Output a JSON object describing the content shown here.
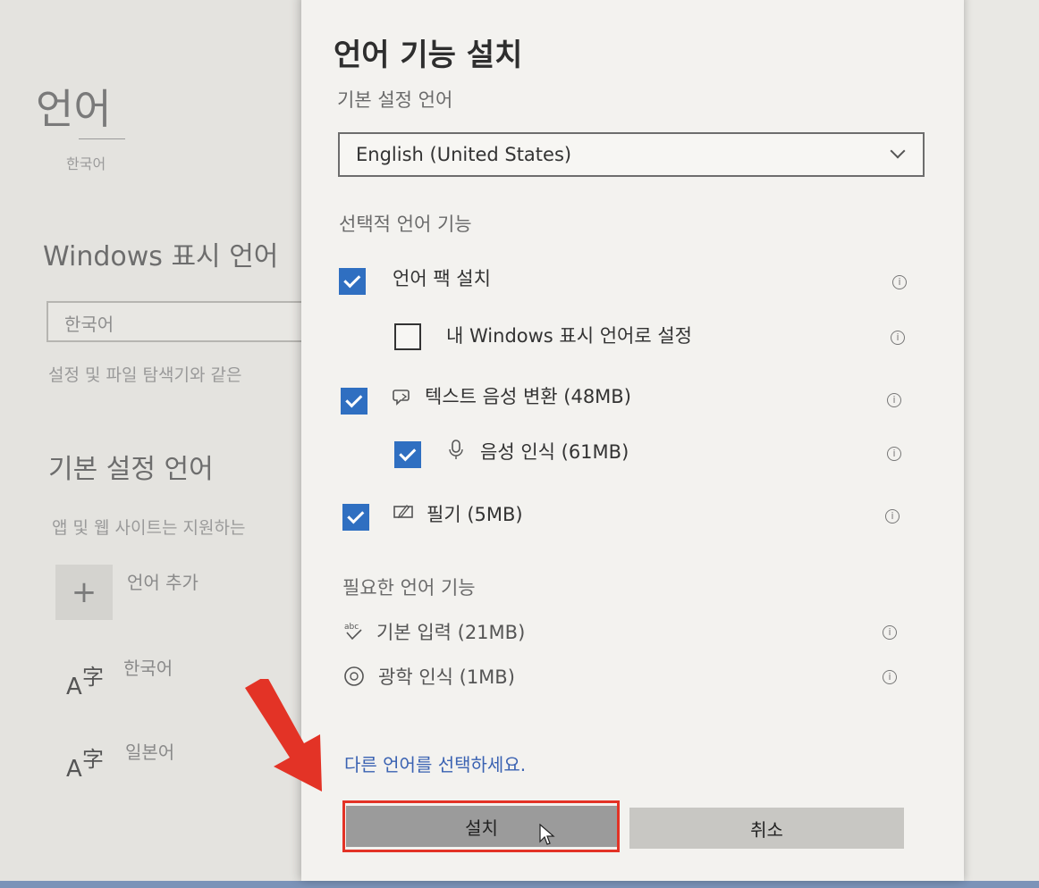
{
  "background": {
    "page_title": "언어",
    "breadcrumb": "한국어",
    "display_language_heading": "Windows 표시 언어",
    "display_language_value": "한국어",
    "display_language_desc": "설정 및 파일 탐색기와 같은",
    "preferred_heading": "기본 설정 언어",
    "preferred_desc": "앱 및 웹 사이트는 지원하는",
    "add_language_label": "언어 추가",
    "languages": [
      "한국어",
      "일본어"
    ]
  },
  "dialog": {
    "title": "언어 기능 설치",
    "preferred_language_label": "기본 설정 언어",
    "preferred_language_value": "English (United States)",
    "optional_heading": "선택적 언어 기능",
    "optional_features": [
      {
        "label": "언어 팩 설치",
        "checked": true,
        "icon": "none"
      },
      {
        "label": "내 Windows 표시 언어로 설정",
        "checked": false,
        "icon": "none"
      },
      {
        "label": "텍스트 음성 변환 (48MB)",
        "checked": true,
        "icon": "speech-bubble-icon"
      },
      {
        "label": "음성 인식 (61MB)",
        "checked": true,
        "icon": "microphone-icon"
      },
      {
        "label": "필기 (5MB)",
        "checked": true,
        "icon": "handwriting-icon"
      }
    ],
    "required_heading": "필요한 언어 기능",
    "required_features": [
      {
        "label": "기본 입력 (21MB)",
        "icon": "keyboard-input-icon"
      },
      {
        "label": "광학 인식 (1MB)",
        "icon": "eye-icon"
      }
    ],
    "info_glyph": "i",
    "choose_other_link": "다른 언어를 선택하세요.",
    "install_button": "설치",
    "cancel_button": "취소"
  },
  "colors": {
    "checkbox_accent": "#2f6fc1",
    "highlight": "#e33326",
    "link": "#3a62b2"
  }
}
